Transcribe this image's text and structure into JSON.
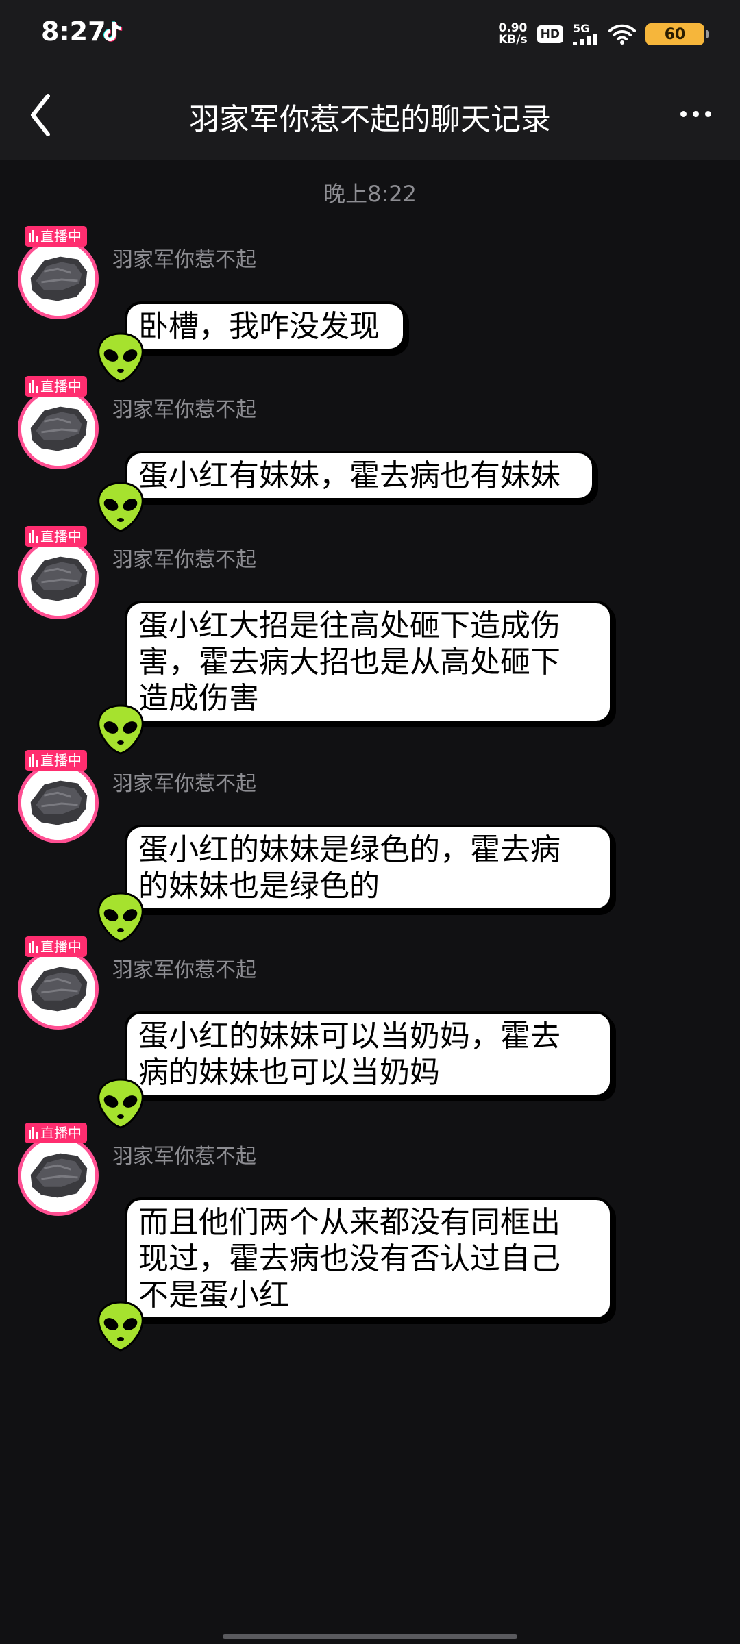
{
  "status_bar": {
    "time": "8:27",
    "net_speed_value": "0.90",
    "net_speed_unit": "KB/s",
    "hd_label": "HD",
    "network": "5G",
    "battery": "60"
  },
  "header": {
    "title": "羽家军你惹不起的聊天记录"
  },
  "timestamp": "晚上8:22",
  "live_badge_label": "直播中",
  "messages": [
    {
      "sender": "羽家军你惹不起",
      "lines": [
        "卧槽，我咋没发现"
      ]
    },
    {
      "sender": "羽家军你惹不起",
      "lines": [
        "蛋小红有妹妹，霍去病也有妹妹"
      ]
    },
    {
      "sender": "羽家军你惹不起",
      "lines": [
        "蛋小红大招是往高处砸下造成伤",
        "害，霍去病大招也是从高处砸下",
        "造成伤害"
      ]
    },
    {
      "sender": "羽家军你惹不起",
      "lines": [
        "蛋小红的妹妹是绿色的，霍去病",
        "的妹妹也是绿色的"
      ]
    },
    {
      "sender": "羽家军你惹不起",
      "lines": [
        "蛋小红的妹妹可以当奶妈，霍去",
        "病的妹妹也可以当奶妈"
      ]
    },
    {
      "sender": "羽家军你惹不起",
      "lines": [
        "而且他们两个从来都没有同框出",
        "现过，霍去病也没有否认过自己",
        "不是蛋小红"
      ]
    }
  ],
  "colors": {
    "background": "#111113",
    "header": "#1b1b1d",
    "live_badge": "#ff2d6f",
    "avatar_ring": "#ff4f92",
    "battery": "#f6b63b",
    "alien_sticker": "#a6e22e"
  }
}
